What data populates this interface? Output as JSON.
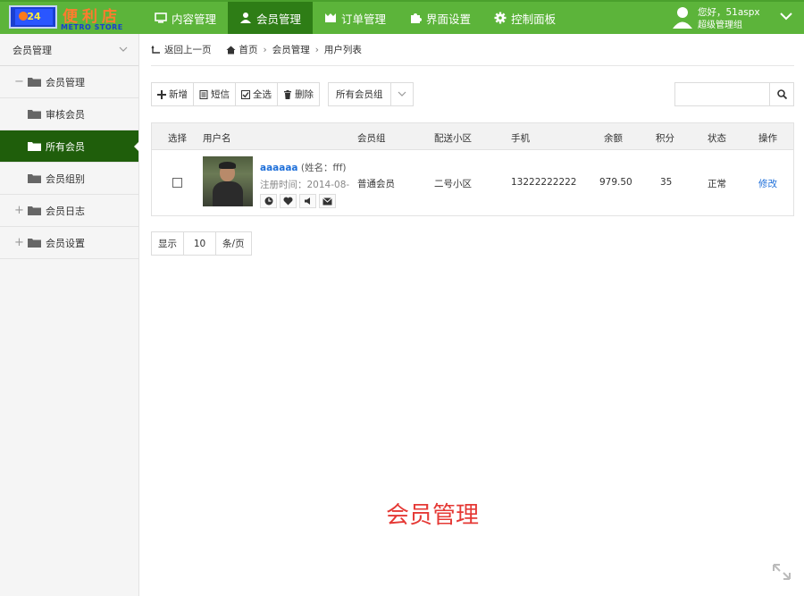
{
  "logo": {
    "cn": "便利店",
    "en": "METRO STORE",
    "badge": "24"
  },
  "nav": [
    {
      "label": "内容管理",
      "icon": "monitor-icon",
      "active": false
    },
    {
      "label": "会员管理",
      "icon": "user-icon",
      "active": true
    },
    {
      "label": "订单管理",
      "icon": "order-icon",
      "active": false
    },
    {
      "label": "界面设置",
      "icon": "puzzle-icon",
      "active": false
    },
    {
      "label": "控制面板",
      "icon": "gear-icon",
      "active": false
    }
  ],
  "user": {
    "greeting": "您好，51aspx",
    "role": "超级管理组"
  },
  "sidebar": {
    "title": "会员管理",
    "items": [
      {
        "label": "会员管理",
        "toggle": "−",
        "level": 1
      },
      {
        "label": "审核会员",
        "toggle": "",
        "level": 2
      },
      {
        "label": "所有会员",
        "toggle": "",
        "level": 2,
        "active": true
      },
      {
        "label": "会员组别",
        "toggle": "",
        "level": 2
      },
      {
        "label": "会员日志",
        "toggle": "+",
        "level": 1
      },
      {
        "label": "会员设置",
        "toggle": "+",
        "level": 1
      }
    ]
  },
  "breadcrumb": {
    "back": "返回上一页",
    "home": "首页",
    "section": "会员管理",
    "current": "用户列表"
  },
  "toolbar": {
    "add": "新增",
    "sms": "短信",
    "select_all": "全选",
    "delete": "删除",
    "group_select": "所有会员组"
  },
  "search": {
    "placeholder": ""
  },
  "table": {
    "headers": [
      "选择",
      "用户名",
      "会员组",
      "配送小区",
      "手机",
      "余额",
      "积分",
      "状态",
      "操作"
    ],
    "rows": [
      {
        "username": "aaaaaa",
        "realname": "(姓名：fff)",
        "regtime": "注册时间：2014-08-",
        "group": "普通会员",
        "area": "二号小区",
        "phone": "13222222222",
        "balance": "979.50",
        "points": "35",
        "status": "正常",
        "action": "修改"
      }
    ]
  },
  "pager": {
    "show": "显示",
    "size": "10",
    "unit": "条/页"
  },
  "watermark": "会员管理",
  "colors": {
    "topbar": "#5cb43a",
    "nav_active": "#2e7d16",
    "side_active": "#1f5e0b",
    "link": "#1e6fd9",
    "watermark": "#e53935"
  }
}
